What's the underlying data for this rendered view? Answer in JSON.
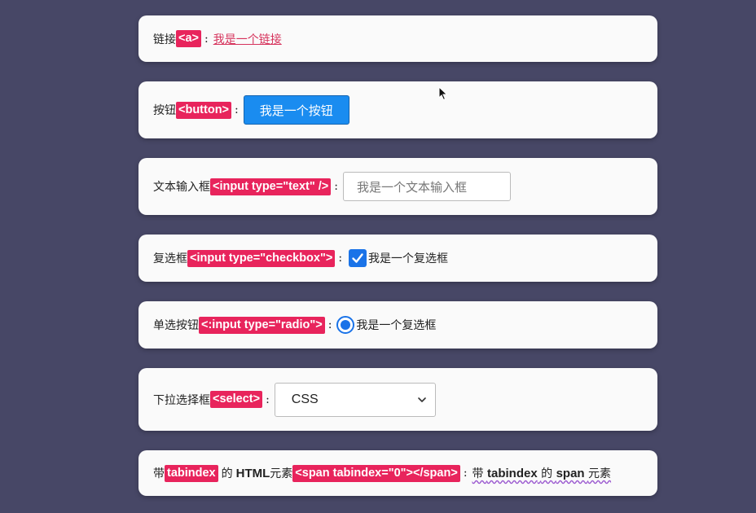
{
  "colors": {
    "background": "#474766",
    "card": "#fafafa",
    "tag": "#e8245c",
    "link": "#d6335c",
    "button": "#1a8cf0",
    "checkbox": "#1a73e8"
  },
  "rows": {
    "link": {
      "label": "链接",
      "tag": "<a>",
      "colon": ":",
      "link_text": "我是一个链接"
    },
    "button": {
      "label": "按钮",
      "tag": "<button>",
      "colon": ":",
      "button_text": "我是一个按钮"
    },
    "text_input": {
      "label": "文本输入框",
      "tag": "<input type=\"text\" />",
      "colon": ":",
      "placeholder": "我是一个文本输入框"
    },
    "checkbox": {
      "label": "复选框",
      "tag": "<input type=\"checkbox\">",
      "colon": ":",
      "checked": true,
      "option_text": "我是一个复选框"
    },
    "radio": {
      "label": "单选按钮",
      "tag": "<:input type=\"radio\">",
      "colon": ":",
      "selected": true,
      "option_text": "我是一个复选框"
    },
    "select": {
      "label": "下拉选择框",
      "tag": "<select>",
      "colon": ":",
      "selected_value": "CSS"
    },
    "span": {
      "label_prefix": "带",
      "tag_inline": "tabindex",
      "label_mid": "的",
      "label_html": "HTML",
      "label_suffix": "元素",
      "tag": "<span tabindex=\"0\"></span>",
      "colon": ":",
      "span_prefix": "带",
      "span_tabindex": "tabindex",
      "span_mid": "的",
      "span_span": "span",
      "span_suffix": "元素"
    }
  }
}
